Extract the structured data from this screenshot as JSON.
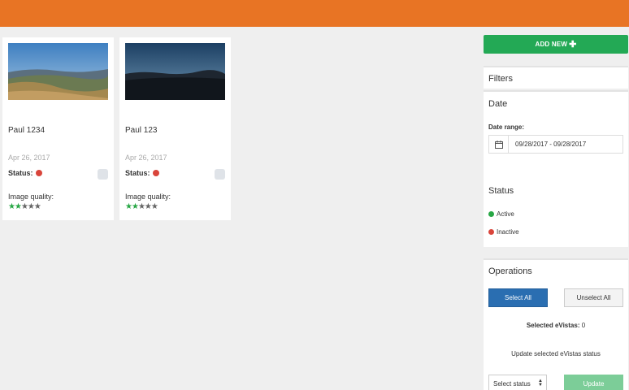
{
  "cards": [
    {
      "title": "Paul 1234",
      "date": "Apr 26, 2017",
      "status_label": "Status:",
      "quality_label": "Image quality:",
      "rating": 2,
      "max_rating": 5
    },
    {
      "title": "Paul 123",
      "date": "Apr 26, 2017",
      "status_label": "Status:",
      "quality_label": "Image quality:",
      "rating": 2,
      "max_rating": 5
    }
  ],
  "sidebar": {
    "add_new_label": "ADD NEW",
    "add_new_icon": "plus-icon",
    "filters_title": "Filters",
    "date": {
      "title": "Date",
      "range_label": "Date range:",
      "range_value": "09/28/2017 - 09/28/2017",
      "icon": "calendar-icon"
    },
    "status": {
      "title": "Status",
      "items": [
        {
          "label": "Active",
          "color": "#28a745"
        },
        {
          "label": "Inactive",
          "color": "#d9453b"
        }
      ]
    },
    "operations": {
      "title": "Operations",
      "select_all_label": "Select All",
      "unselect_all_label": "Unselect All",
      "selected_label": "Selected eVistas:",
      "selected_count": "0",
      "update_title": "Update selected eVistas status",
      "select_status_value": "Select status",
      "update_label": "Update"
    }
  },
  "colors": {
    "topbar": "#e87424",
    "add_new": "#23a955",
    "select_all": "#2a6eb1",
    "update": "#7ccd98",
    "status_inactive": "#d9453b"
  }
}
